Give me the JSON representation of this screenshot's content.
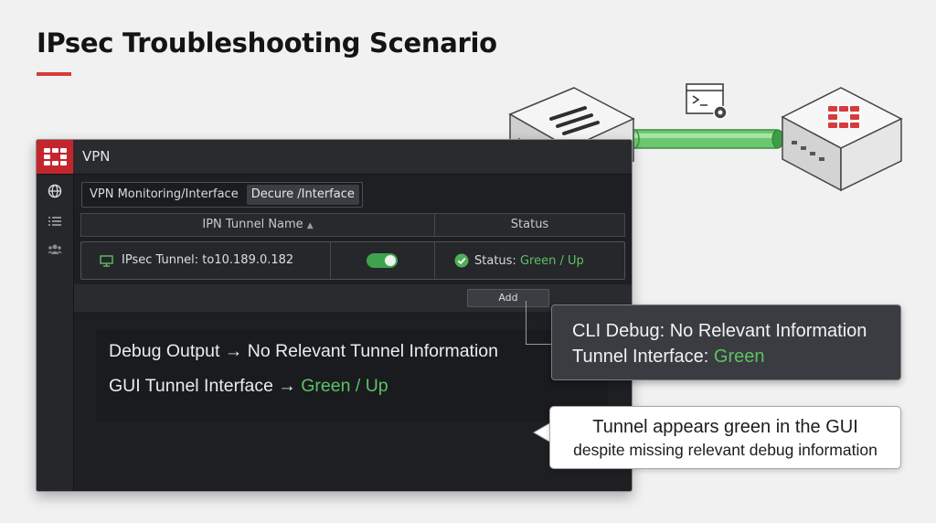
{
  "slide": {
    "title": "IPsec Troubleshooting Scenario"
  },
  "colors": {
    "accent_red": "#d63b3b",
    "fortinet_red": "#c4262e",
    "status_green": "#5cc165",
    "tunnel_green": "#4fbf58",
    "window_bg": "#1e1f22"
  },
  "diagram": {
    "icons": [
      "network-switch-icon",
      "terminal-gear-icon",
      "green-tunnel-pipe",
      "fortigate-appliance-icon"
    ]
  },
  "window": {
    "title": "VPN",
    "logo": "fortinet-logo-icon",
    "sidebar_icons": [
      "globe-icon",
      "list-icon",
      "users-icon"
    ],
    "tabs": [
      {
        "label": "VPN Monitoring/Interface",
        "active": false
      },
      {
        "label": "Decure /Interface",
        "active": true
      }
    ],
    "table": {
      "headers": {
        "name": "IPN Tunnel Name",
        "status": "Status"
      },
      "rows": [
        {
          "name": "IPsec Tunnel: to10.189.0.182",
          "enabled": true,
          "status_prefix": "Status: ",
          "status_value": "Green / Up"
        }
      ]
    },
    "add_button": "Add",
    "debug": {
      "line1": "Debug Output → No Relevant Tunnel Information",
      "line2_prefix": "GUI Tunnel Interface → ",
      "line2_value": "Green / Up"
    }
  },
  "callouts": {
    "cli": {
      "line1": "CLI Debug: No Relevant Information",
      "line2_prefix": "Tunnel Interface: ",
      "line2_value": "Green"
    },
    "note": {
      "line1": "Tunnel appears green in the GUI",
      "line2": "despite missing relevant debug information"
    }
  }
}
